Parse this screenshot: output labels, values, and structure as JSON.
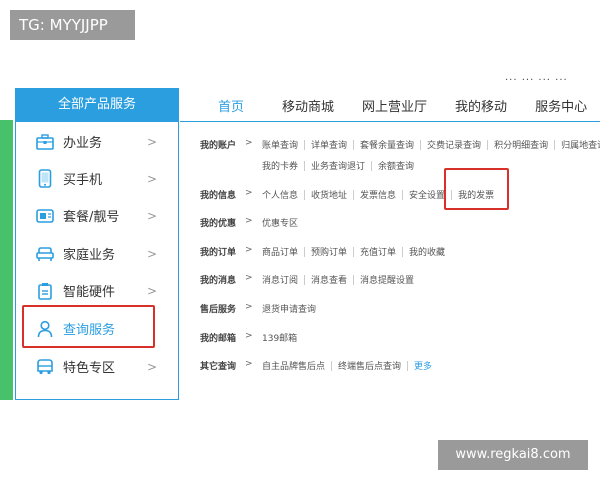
{
  "overlay_tag": "TG: MYYJJPP",
  "top_cutoff": "... ... ... ...",
  "sidebar": {
    "title": "全部产品服务",
    "items": [
      {
        "label": "办业务",
        "icon": "briefcase-icon"
      },
      {
        "label": "买手机",
        "icon": "phone-icon"
      },
      {
        "label": "套餐/靓号",
        "icon": "sim-card-icon"
      },
      {
        "label": "家庭业务",
        "icon": "sofa-icon"
      },
      {
        "label": "智能硬件",
        "icon": "device-icon"
      },
      {
        "label": "查询服务",
        "icon": "user-icon"
      },
      {
        "label": "特色专区",
        "icon": "bus-icon"
      }
    ],
    "chevron": ">"
  },
  "topnav": {
    "items": [
      "首页",
      "移动商城",
      "网上营业厅",
      "我的移动",
      "服务中心"
    ]
  },
  "content": {
    "arrow": ">",
    "rows": [
      {
        "label": "我的账户",
        "links": [
          "账单查询",
          "详单查询",
          "套餐余量查询",
          "交费记录查询",
          "积分明细查询",
          "归属地查询"
        ],
        "links2": [
          "我的卡券",
          "业务查询退订",
          "余额查询"
        ]
      },
      {
        "label": "我的信息",
        "links": [
          "个人信息",
          "收货地址",
          "发票信息",
          "安全设置",
          "我的发票"
        ]
      },
      {
        "label": "我的优惠",
        "links": [
          "优惠专区"
        ]
      },
      {
        "label": "我的订单",
        "links": [
          "商品订单",
          "预购订单",
          "充值订单",
          "我的收藏"
        ]
      },
      {
        "label": "我的消息",
        "links": [
          "消息订阅",
          "消息查看",
          "消息提醒设置"
        ]
      },
      {
        "label": "售后服务",
        "links": [
          "退货申请查询"
        ]
      },
      {
        "label": "我的邮箱",
        "links": [
          "139邮箱"
        ]
      },
      {
        "label": "其它查询",
        "links": [
          "自主品牌售后点",
          "终端售后点查询"
        ],
        "more": "更多"
      }
    ]
  },
  "watermark": "www.regkai8.com",
  "colors": {
    "accent": "#2b9ee0",
    "green": "#48c26a",
    "highlight": "#d8312a"
  }
}
